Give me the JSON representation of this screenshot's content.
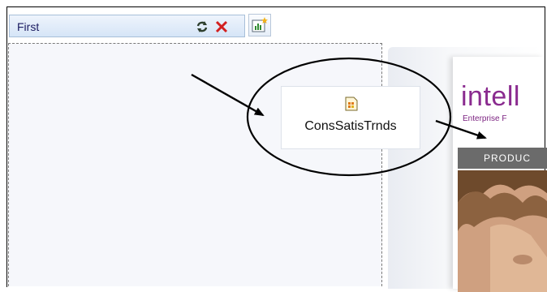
{
  "panel": {
    "title": "First",
    "refresh_icon": "refresh-icon",
    "close_icon": "close-icon",
    "toolbar_icon": "report-chart-icon"
  },
  "report_item": {
    "label": "ConsSatisTrnds",
    "icon": "report-document-icon"
  },
  "preview": {
    "brand_text": "intell",
    "tagline": "Enterprise F",
    "nav_label": "PRODUC"
  },
  "colors": {
    "brand": "#8a2b8f",
    "header_bg": "#d6e5f7",
    "nav_band": "#6b6b6b"
  }
}
